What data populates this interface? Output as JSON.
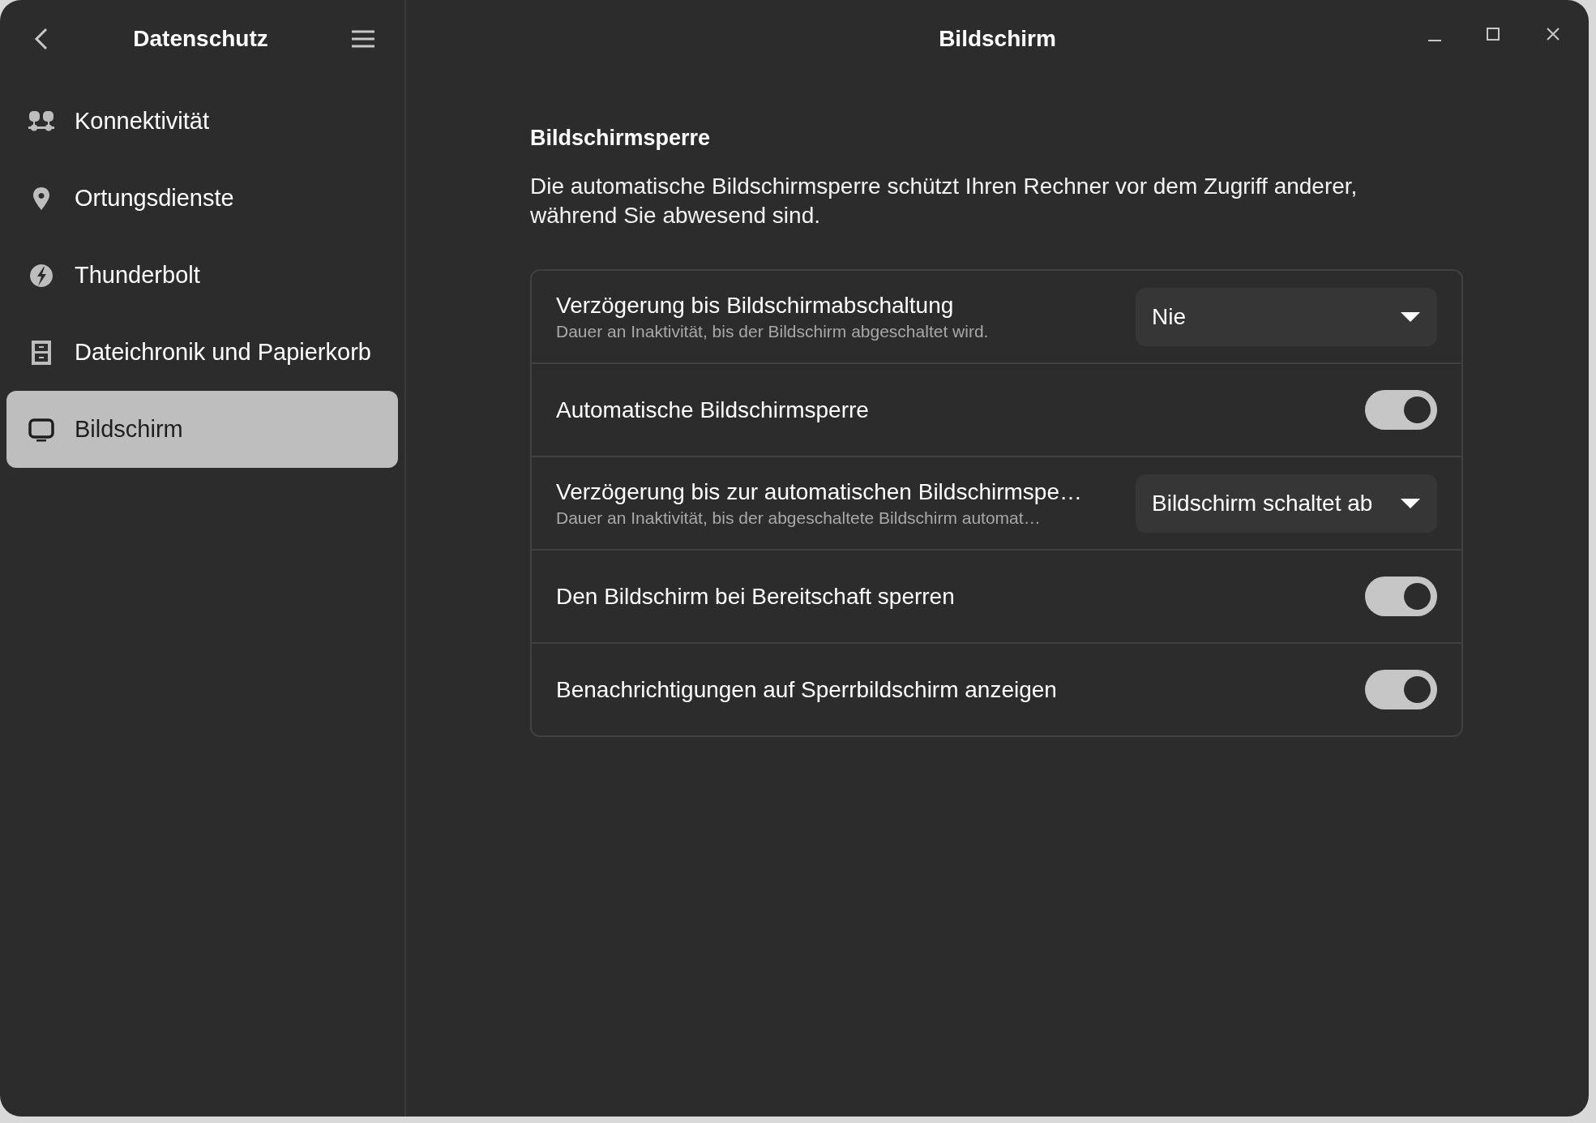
{
  "sidebar": {
    "title": "Datenschutz",
    "items": [
      {
        "label": "Konnektivität",
        "selected": false
      },
      {
        "label": "Ortungsdienste",
        "selected": false
      },
      {
        "label": "Thunderbolt",
        "selected": false
      },
      {
        "label": "Dateichronik und Papierkorb",
        "selected": false
      },
      {
        "label": "Bildschirm",
        "selected": true
      }
    ]
  },
  "window": {
    "title": "Bildschirm"
  },
  "section": {
    "heading": "Bildschirmsperre",
    "description": "Die automatische Bildschirmsperre schützt Ihren Rechner vor dem Zugriff anderer, während Sie abwesend sind.",
    "rows": [
      {
        "kind": "dropdown",
        "title": "Verzögerung bis Bildschirmabschaltung",
        "subtitle": "Dauer an Inaktivität, bis der Bildschirm abgeschaltet wird.",
        "value": "Nie"
      },
      {
        "kind": "toggle",
        "title": "Automatische Bildschirmsperre",
        "on": true
      },
      {
        "kind": "dropdown",
        "title": "Verzögerung bis zur automatischen Bildschirmspe…",
        "subtitle": "Dauer an Inaktivität, bis der abgeschaltete Bildschirm automat…",
        "value": "Bildschirm schaltet ab"
      },
      {
        "kind": "toggle",
        "title": "Den Bildschirm bei Bereitschaft sperren",
        "on": true
      },
      {
        "kind": "toggle",
        "title": "Benachrichtigungen auf Sperrbildschirm anzeigen",
        "on": true
      }
    ]
  }
}
